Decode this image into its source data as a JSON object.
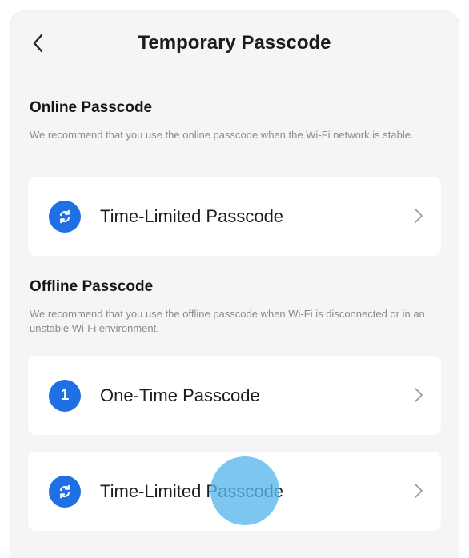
{
  "header": {
    "title": "Temporary Passcode",
    "back_icon": "chevron-left-icon"
  },
  "online": {
    "title": "Online Passcode",
    "description": "We recommend that you use the online passcode when the Wi-Fi network is stable.",
    "items": [
      {
        "label": "Time-Limited Passcode",
        "icon": "sync-icon"
      }
    ]
  },
  "offline": {
    "title": "Offline Passcode",
    "description": "We recommend that you use the offline passcode when Wi-Fi is disconnected or in an unstable Wi-Fi environment.",
    "items": [
      {
        "label": "One-Time Passcode",
        "icon": "number-one-icon",
        "icon_text": "1"
      },
      {
        "label": "Time-Limited Passcode",
        "icon": "sync-icon"
      }
    ]
  },
  "colors": {
    "accent": "#1f6fe5",
    "background": "#f5f5f5",
    "card": "#ffffff",
    "touch": "#59b6ec"
  }
}
